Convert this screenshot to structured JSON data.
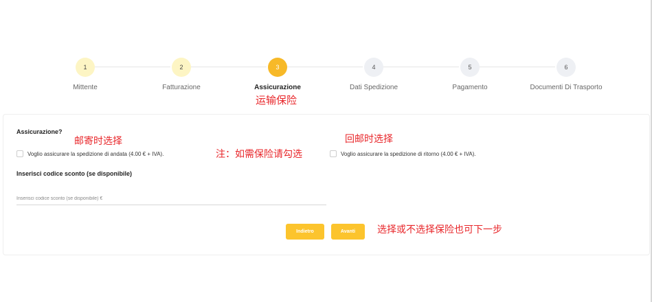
{
  "stepper": {
    "steps": [
      {
        "number": "1",
        "label": "Mittente",
        "state": "done"
      },
      {
        "number": "2",
        "label": "Fatturazione",
        "state": "done"
      },
      {
        "number": "3",
        "label": "Assicurazione",
        "state": "active"
      },
      {
        "number": "4",
        "label": "Dati Spedizione",
        "state": "todo"
      },
      {
        "number": "5",
        "label": "Pagamento",
        "state": "todo"
      },
      {
        "number": "6",
        "label": "Documenti Di Trasporto",
        "state": "todo"
      }
    ]
  },
  "annotations": {
    "step3_note": "运输保险",
    "outbound_note": "邮寄时选择",
    "tick_note": "注：如需保险请勾选",
    "return_note": "回邮时选择",
    "next_note": "选择或不选择保险也可下一步"
  },
  "form": {
    "question": "Assicurazione?",
    "outbound_checkbox": "Voglio assicurare la spedizione di andata (4.00 € + IVA).",
    "return_checkbox": "Voglio assicurare la spedizione di ritorno (4.00 € + IVA).",
    "discount_label": "Inserisci codice sconto (se disponibile)",
    "discount_placeholder": "Inserisci codice sconto (se disponibile) €",
    "back_label": "Indietro",
    "next_label": "Avanti"
  },
  "colors": {
    "accent": "#f7b928",
    "button": "#fcc42d",
    "done_circle": "#fdf5c4",
    "todo_circle": "#eef0f4",
    "annotation": "#e8262a"
  }
}
